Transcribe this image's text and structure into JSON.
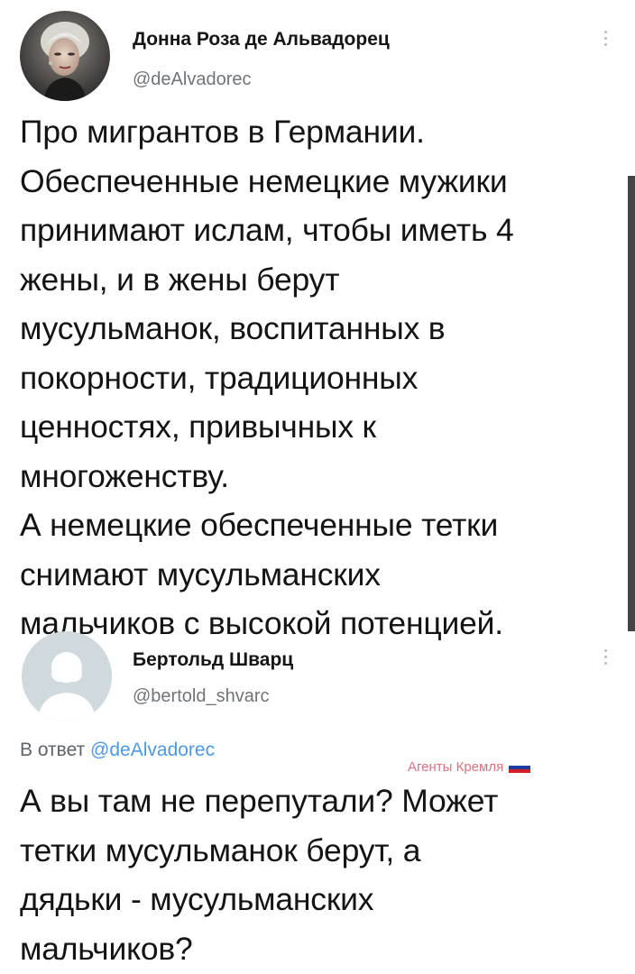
{
  "colors": {
    "handle": "#6f7479",
    "link": "#4a99e9",
    "watermark": "#e07080",
    "flag": [
      "#ffffff",
      "#1f3fa0",
      "#d41f25"
    ]
  },
  "tweets": [
    {
      "author_name": "Донна Роза де Альвадорец",
      "author_handle": "@deAlvadorec",
      "avatar": "user-photo",
      "text": "Про мигрантов в Германии.\nОбеспеченные немецкие мужики\nпринимают ислам, чтобы иметь 4\nжены, и в жены берут\nмусульманок, воспитанных в\nпокорности, традиционных\nценностях, привычных к\nмногоженству.\nА немецкие обеспеченные тетки\nснимают мусульманских\nмальчиков с высокой потенцией."
    },
    {
      "author_name": "Бертольд Шварц",
      "author_handle": "@bertold_shvarc",
      "avatar": "default-avatar-icon",
      "reply_prefix": "В ответ ",
      "reply_handle": "@deAlvadorec",
      "text": "А вы там не перепутали? Может\nтетки мусульманок берут, а\nдядьки - мусульманских\nмальчиков?"
    }
  ],
  "watermark": {
    "text": "Агенты Кремля",
    "icon": "flag-icon"
  }
}
